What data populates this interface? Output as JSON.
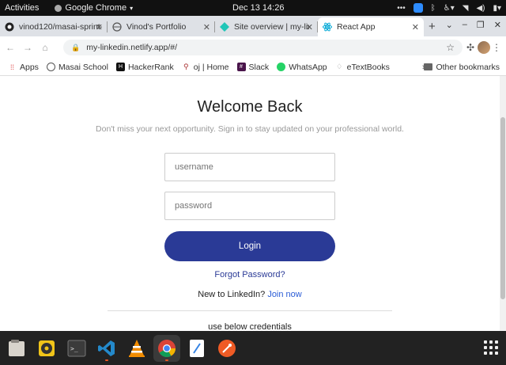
{
  "topbar": {
    "activities": "Activities",
    "app_name": "Google Chrome",
    "clock": "Dec 13  14:26"
  },
  "tabs": [
    {
      "title": "vinod120/masai-sprint-",
      "icon": "github-icon",
      "active": false
    },
    {
      "title": "Vinod's Portfolio",
      "icon": "globe-icon",
      "active": false
    },
    {
      "title": "Site overview | my-linke",
      "icon": "netlify-icon",
      "active": false
    },
    {
      "title": "React App",
      "icon": "react-icon",
      "active": true
    }
  ],
  "address_bar": {
    "url": "my-linkedin.netlify.app/#/"
  },
  "bookmarks": [
    {
      "label": "Apps",
      "icon": "apps-grid-icon"
    },
    {
      "label": "Masai School",
      "icon": "globe-icon"
    },
    {
      "label": "HackerRank",
      "icon": "hackerrank-icon"
    },
    {
      "label": "oj | Home",
      "icon": "pin-icon"
    },
    {
      "label": "Slack",
      "icon": "slack-icon"
    },
    {
      "label": "WhatsApp",
      "icon": "whatsapp-icon"
    },
    {
      "label": "eTextBooks",
      "icon": "bulb-icon"
    }
  ],
  "other_bookmarks": "Other bookmarks",
  "page": {
    "heading": "Welcome Back",
    "subtitle": "Don't miss your next opportunity. Sign in to stay updated on your professional world.",
    "username_placeholder": "username",
    "password_placeholder": "password",
    "login_label": "Login",
    "forgot_label": "Forgot Password?",
    "new_to": "New to LinkedIn?",
    "join_label": "Join now",
    "credentials_note": "use below credentials"
  },
  "colors": {
    "primary": "#2a3a96",
    "link": "#2a5cd6",
    "dock_bg": "#222222"
  },
  "dock": [
    {
      "name": "files-icon"
    },
    {
      "name": "rhythmbox-icon"
    },
    {
      "name": "terminal-icon"
    },
    {
      "name": "vscode-icon"
    },
    {
      "name": "vlc-icon"
    },
    {
      "name": "chrome-icon",
      "active": true
    },
    {
      "name": "text-editor-icon"
    },
    {
      "name": "postman-icon"
    }
  ]
}
